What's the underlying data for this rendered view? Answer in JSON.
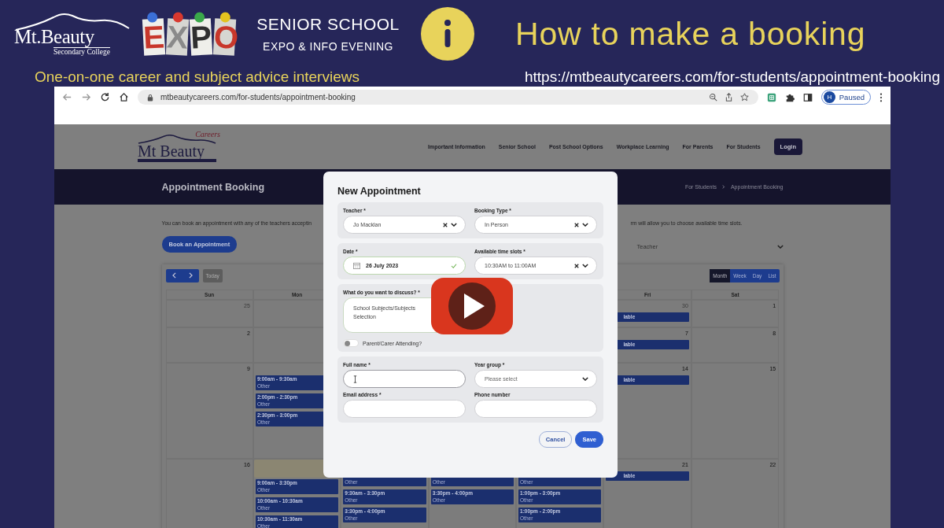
{
  "slide": {
    "logo": {
      "name": "Mt.Beauty",
      "subtitle": "Secondary College"
    },
    "expo_tiles": [
      {
        "letter": "E",
        "color": "#c8372b"
      },
      {
        "letter": "X",
        "color": "#8a8a8a"
      },
      {
        "letter": "P",
        "color": "#2f2f2f"
      },
      {
        "letter": "O",
        "color": "#c8372b"
      }
    ],
    "event_title": "SENIOR SCHOOL",
    "event_subtitle": "EXPO & INFO EVENING",
    "heading": "How to make a booking",
    "tagline": "One-on-one career and subject advice interviews",
    "link": "https://mtbeautycareers.com/for-students/appointment-booking"
  },
  "browser": {
    "url": "mtbeautycareers.com/for-students/appointment-booking",
    "profile_initial": "H",
    "profile_status": "Paused"
  },
  "site": {
    "logo": {
      "name": "Mt Beauty",
      "tag": "Careers"
    },
    "nav": [
      "Important Information",
      "Senior School",
      "Post School Options",
      "Workplace Learning",
      "For Parents",
      "For Students"
    ],
    "login": "Login",
    "page_title": "Appointment Booking",
    "breadcrumbs": [
      "For Students",
      "Appointment Booking"
    ],
    "intro_start": "You can book an appointment with any of the teachers acceptin",
    "intro_end": "rm will allow you to choose available time slots.",
    "book_button": "Book an Appointment",
    "teacher_filter": {
      "placeholder": "Teacher"
    },
    "calendar": {
      "today_button": "Today",
      "views": [
        {
          "label": "Month",
          "selected": true
        },
        {
          "label": "Week",
          "selected": false
        },
        {
          "label": "Day",
          "selected": false
        },
        {
          "label": "List",
          "selected": false
        }
      ],
      "weekday_headers": {
        "sun": "Sun",
        "mon": "Mon",
        "fri": "Fri",
        "sat": "Sat"
      },
      "weeks": [
        {
          "sun": {
            "number": "25",
            "other_month": true
          },
          "fri": {
            "number": "30",
            "other_month": true,
            "events": [
              {
                "title": "lable"
              }
            ]
          },
          "sat": {
            "number": "1",
            "other_month": false
          }
        },
        {
          "sun": {
            "number": "2",
            "other_month": false
          },
          "fri": {
            "number": "7",
            "other_month": false,
            "events": [
              {
                "title": "lable"
              }
            ]
          },
          "sat": {
            "number": "8",
            "other_month": false
          }
        },
        {
          "sun": {
            "number": "9",
            "other_month": false
          },
          "mon": {
            "events": [
              {
                "time": "9:00am - 9:30am",
                "type": "Other"
              },
              {
                "time": "2:00pm - 2:30pm",
                "type": "Other"
              },
              {
                "time": "2:30pm - 3:00pm",
                "type": "Other"
              }
            ]
          },
          "fri": {
            "number": "14",
            "other_month": false,
            "events": [
              {
                "title": "lable"
              }
            ]
          },
          "sat": {
            "number": "15",
            "other_month": false
          }
        },
        {
          "sun": {
            "number": "16",
            "other_month": false
          },
          "mon": {
            "today": true,
            "events": [
              {
                "time": "9:00am - 3:30pm",
                "type": "Other"
              },
              {
                "time": "10:00am - 10:30am",
                "type": "Other"
              },
              {
                "time": "10:30am - 11:30am",
                "type": "Other"
              }
            ]
          },
          "tue": {
            "events": [
              {
                "type": "Other"
              },
              {
                "time": "9:30am - 3:30pm",
                "type": "Other"
              },
              {
                "time": "3:30pm - 4:00pm",
                "type": "Other"
              }
            ]
          },
          "wed": {
            "events": [
              {
                "type": "Other"
              },
              {
                "time": "3:30pm - 4:00pm",
                "type": "Other"
              }
            ]
          },
          "thu": {
            "events": [
              {
                "type": "Other"
              },
              {
                "time": "1:00pm - 3:00pm",
                "type": "Other"
              },
              {
                "time": "1:00pm - 2:00pm",
                "type": "Other"
              }
            ]
          },
          "fri": {
            "number": "21",
            "other_month": false,
            "events": [
              {
                "title": "lable"
              }
            ]
          },
          "sat": {
            "number": "22",
            "other_month": false
          }
        }
      ]
    }
  },
  "modal": {
    "title": "New Appointment",
    "sections": [
      [
        {
          "kind": "select",
          "label": "Teacher *",
          "value": "Jo Macklan",
          "clearable": true
        },
        {
          "kind": "select",
          "label": "Booking Type *",
          "value": "In Person",
          "clearable": true
        }
      ],
      [
        {
          "kind": "date",
          "label": "Date *",
          "value": "26 July 2023",
          "valid": true
        },
        {
          "kind": "select",
          "label": "Available time slots *",
          "value": "10:30AM to 11:00AM",
          "clearable": true
        }
      ],
      [
        {
          "kind": "textarea",
          "label": "What do you want to discuss? *",
          "value": "School Subjects/Subjects Selection"
        },
        {
          "kind": "toggle",
          "label": "Parent/Carer Attending?",
          "on": false
        }
      ],
      [
        {
          "kind": "text",
          "label": "Full name *",
          "focused": true
        },
        {
          "kind": "select",
          "label": "Year group *",
          "placeholder": "Please select",
          "clearable": false
        },
        {
          "kind": "text",
          "label": "Email address *",
          "focused": false
        },
        {
          "kind": "text",
          "label": "Phone number",
          "focused": false
        }
      ]
    ],
    "buttons": [
      {
        "label": "Cancel",
        "kind": "secondary"
      },
      {
        "label": "Save",
        "kind": "primary"
      }
    ]
  },
  "video": {
    "paused": true
  }
}
